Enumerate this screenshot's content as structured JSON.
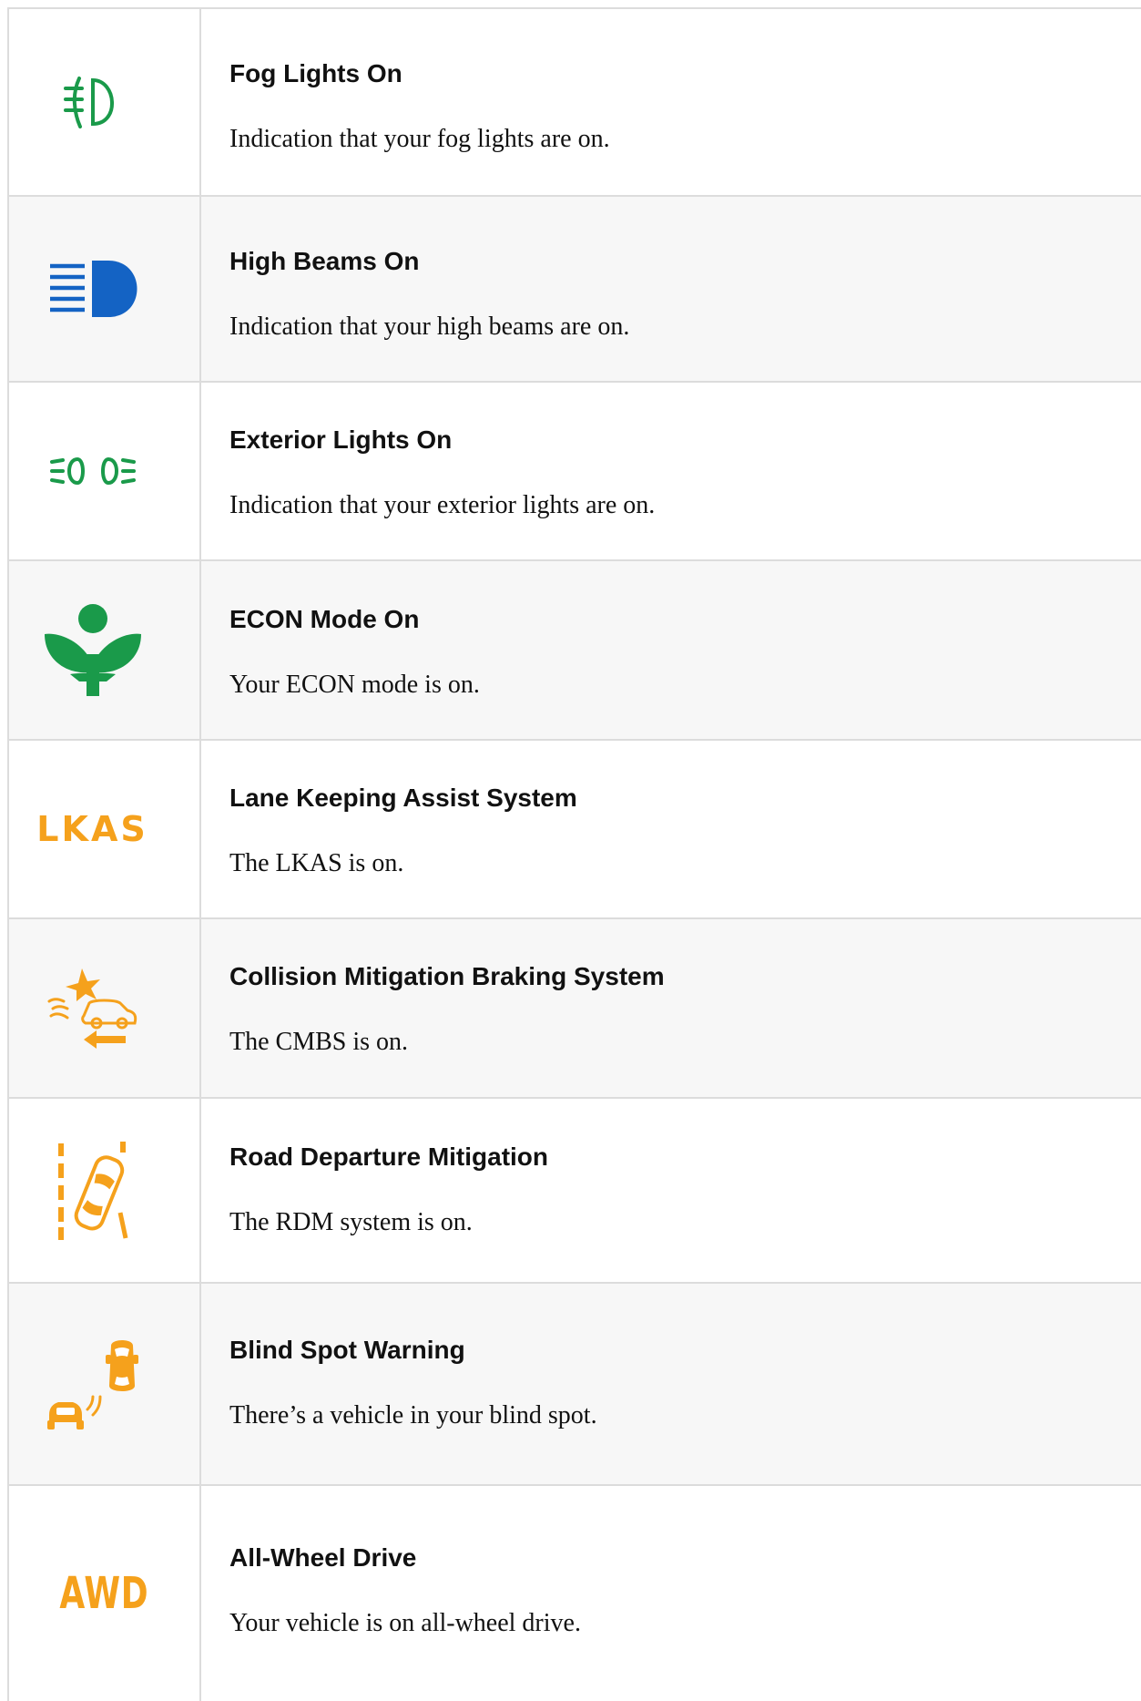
{
  "colors": {
    "green": "#1a9a4a",
    "blue": "#1463c4",
    "orange": "#f5a11c",
    "border": "#dcdcdc",
    "alt_row": "#f7f7f7"
  },
  "rows": [
    {
      "icon": "fog-lights-icon",
      "title": "Fog Lights On",
      "description": "Indication that your fog lights are on."
    },
    {
      "icon": "high-beams-icon",
      "title": "High Beams On",
      "description": "Indication that your high beams are on."
    },
    {
      "icon": "exterior-lights-icon",
      "title": "Exterior Lights On",
      "description": "Indication that your exterior lights are on."
    },
    {
      "icon": "econ-mode-icon",
      "title": "ECON Mode On",
      "description": "Your ECON mode is on."
    },
    {
      "icon": "lkas-icon",
      "icon_text": "LKAS",
      "title": "Lane Keeping Assist System",
      "description": "The LKAS is on."
    },
    {
      "icon": "cmbs-icon",
      "title": "Collision Mitigation Braking System",
      "description": "The CMBS is on."
    },
    {
      "icon": "rdm-icon",
      "title": "Road Departure Mitigation",
      "description": "The RDM system is on."
    },
    {
      "icon": "blind-spot-icon",
      "title": "Blind Spot Warning",
      "description": "There’s a vehicle in your blind spot."
    },
    {
      "icon": "awd-icon",
      "icon_text": "AWD",
      "title": "All-Wheel Drive",
      "description": "Your vehicle is on all-wheel drive."
    }
  ]
}
